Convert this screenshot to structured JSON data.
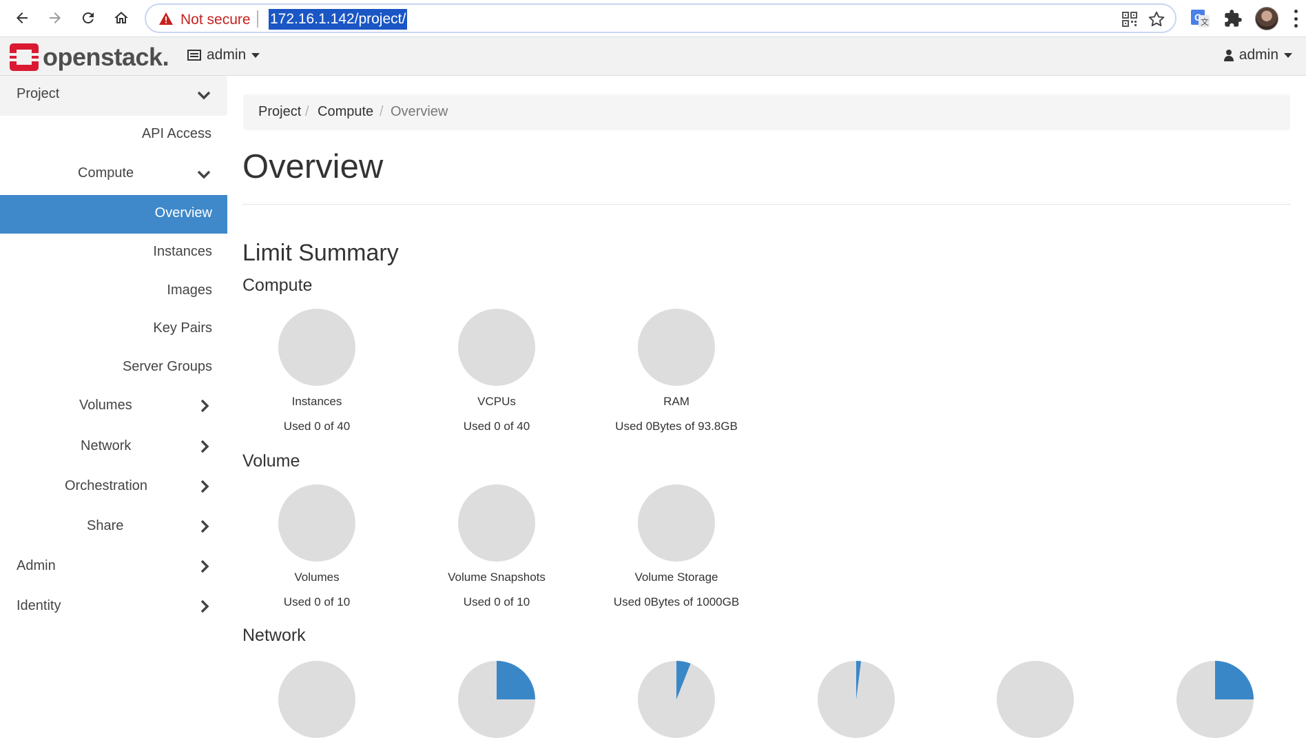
{
  "browser": {
    "security_label": "Not secure",
    "url": "172.16.1.142/project/",
    "icons": [
      "back-icon",
      "forward-icon",
      "reload-icon",
      "home-icon",
      "warning-icon",
      "qr-code-icon",
      "star-icon",
      "translate-icon",
      "puzzle-icon",
      "avatar",
      "more-vert-icon"
    ]
  },
  "header": {
    "logo_text": "openstack.",
    "project_selector": "admin",
    "user_menu": "admin"
  },
  "sidebar": {
    "project": "Project",
    "api_access": "API Access",
    "compute": "Compute",
    "overview": "Overview",
    "instances": "Instances",
    "images": "Images",
    "key_pairs": "Key Pairs",
    "server_groups": "Server Groups",
    "volumes": "Volumes",
    "network": "Network",
    "orchestration": "Orchestration",
    "share": "Share",
    "admin": "Admin",
    "identity": "Identity"
  },
  "breadcrumb": {
    "items": [
      "Project",
      "Compute",
      "Overview"
    ],
    "separator": "/"
  },
  "main": {
    "title": "Overview",
    "limit_summary": "Limit Summary",
    "compute_heading": "Compute",
    "volume_heading": "Volume",
    "network_heading": "Network",
    "compute_limits": [
      {
        "label": "Instances",
        "usage": "Used 0 of 40",
        "used_fraction": 0
      },
      {
        "label": "VCPUs",
        "usage": "Used 0 of 40",
        "used_fraction": 0
      },
      {
        "label": "RAM",
        "usage": "Used 0Bytes of 93.8GB",
        "used_fraction": 0
      }
    ],
    "volume_limits": [
      {
        "label": "Volumes",
        "usage": "Used 0 of 10",
        "used_fraction": 0
      },
      {
        "label": "Volume Snapshots",
        "usage": "Used 0 of 10",
        "used_fraction": 0
      },
      {
        "label": "Volume Storage",
        "usage": "Used 0Bytes of 1000GB",
        "used_fraction": 0
      }
    ],
    "network_limits": [
      {
        "used_fraction": 0
      },
      {
        "used_fraction": 0.25
      },
      {
        "used_fraction": 0.06
      },
      {
        "used_fraction": 0.02
      },
      {
        "used_fraction": 0
      },
      {
        "used_fraction": 0.25
      }
    ]
  },
  "colors": {
    "accent": "#3f88c9",
    "pie_empty": "#dddddd",
    "pie_used": "#3a87c8",
    "not_secure": "#c5221f"
  }
}
